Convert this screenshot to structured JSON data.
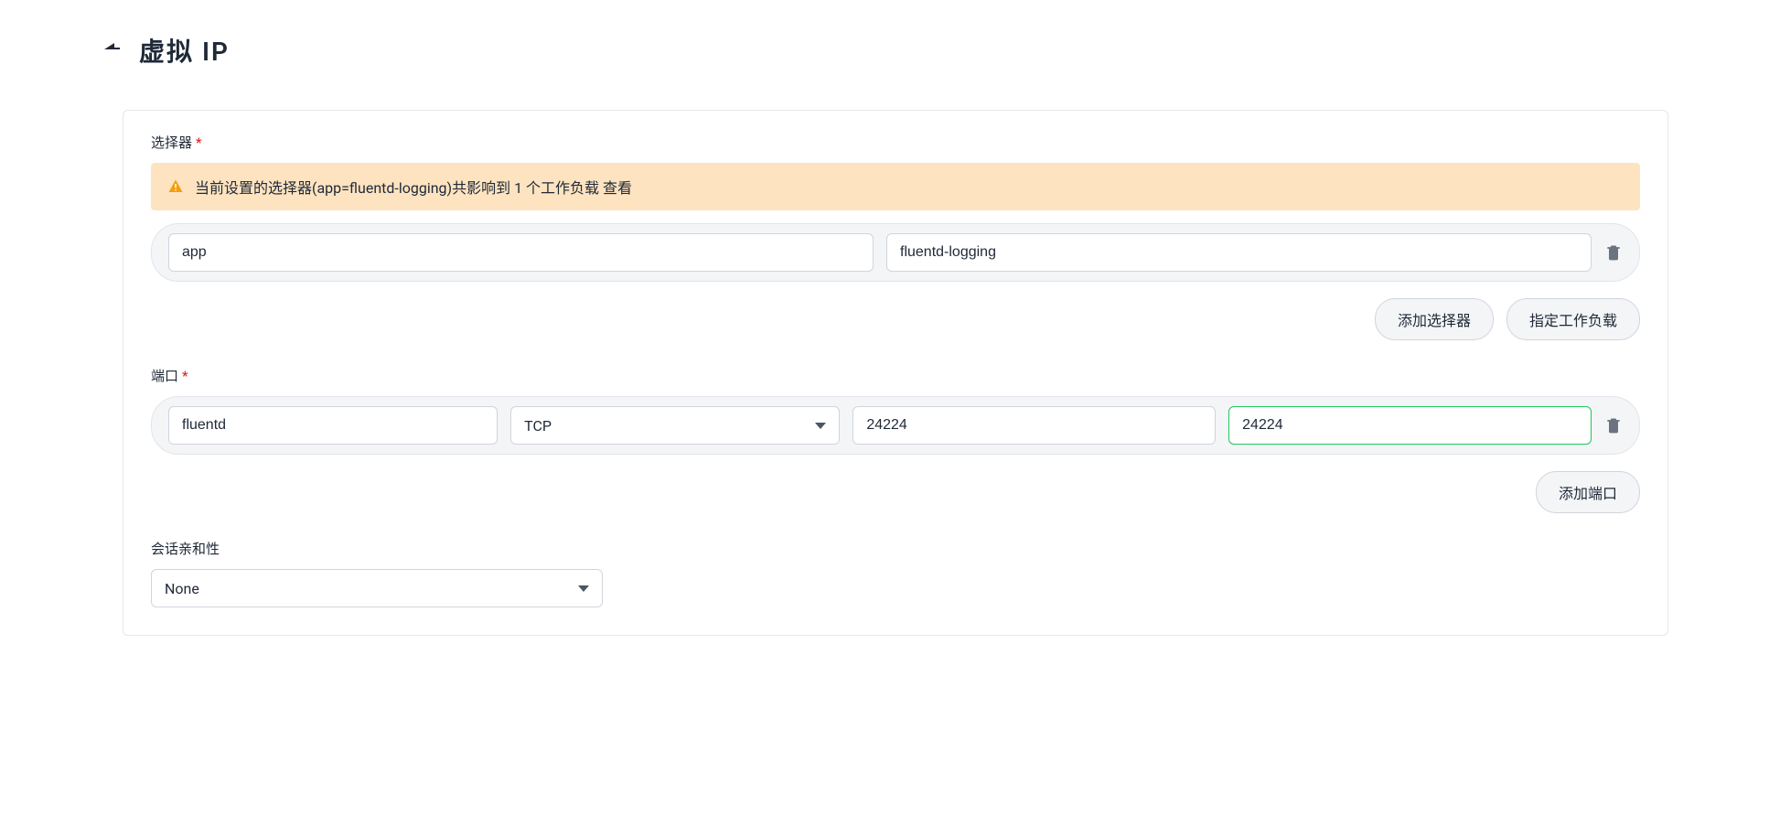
{
  "header": {
    "title": "虚拟 IP"
  },
  "selector_section": {
    "label": "选择器",
    "alert_prefix": "当前设置的选择器(app=fluentd-logging)共影响到 1 个工作负载 ",
    "alert_link": "查看",
    "rows": [
      {
        "key": "app",
        "value": "fluentd-logging"
      }
    ],
    "buttons": {
      "add_selector": "添加选择器",
      "specify_workload": "指定工作负载"
    }
  },
  "port_section": {
    "label": "端口",
    "rows": [
      {
        "name": "fluentd",
        "protocol": "TCP",
        "port": "24224",
        "target_port": "24224"
      }
    ],
    "buttons": {
      "add_port": "添加端口"
    }
  },
  "affinity_section": {
    "label": "会话亲和性",
    "value": "None"
  }
}
